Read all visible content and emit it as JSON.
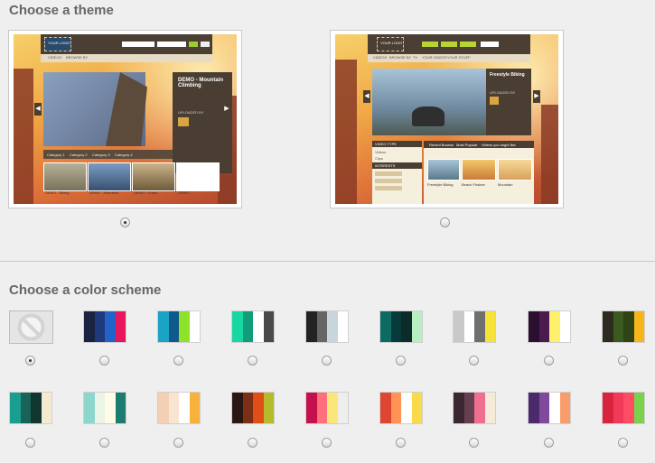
{
  "headings": {
    "theme": "Choose a theme",
    "color": "Choose a color scheme"
  },
  "themes": [
    {
      "logo": "YOUR LOGO",
      "nav": [
        "VIDEOS",
        "BROWSE BY"
      ],
      "hero_title": "DEMO - Mountain Climbing",
      "uploaded_by": "UPLOADED BY",
      "categories": [
        "Category 1",
        "Category 2",
        "Category 3",
        "Category 4"
      ],
      "thumbs": [
        "DEMO - Biking",
        "DEMO - Mountain",
        "DEMO - Cross",
        "DEMO"
      ],
      "selected": true
    },
    {
      "logo": "YOUR LOGO",
      "nav": [
        "VIDEOS",
        "BROWSE BY",
        "TV",
        "YOUR VIDEOS",
        "YOUR STUFF"
      ],
      "hero_title": "Freestyle Biking",
      "uploaded_by": "UPLOADED BY",
      "sidebar": [
        "VIDEO TYPE",
        "Videos",
        "Clips",
        "INTERESTS"
      ],
      "tabs": [
        "Recent Browse",
        "Most Popular",
        "Videos you might like"
      ],
      "thumbs": [
        "Freestyle Biking",
        "Beach Frisbee",
        "Mountain"
      ],
      "selected": false
    }
  ],
  "color_schemes": [
    {
      "colors": [],
      "none": true,
      "selected": true
    },
    {
      "colors": [
        "#1a2340",
        "#1f3a7a",
        "#2263c9",
        "#e8175d"
      ]
    },
    {
      "colors": [
        "#1ba3c6",
        "#0f5a8a",
        "#8de22a",
        "#ffffff"
      ]
    },
    {
      "colors": [
        "#17d8a0",
        "#0f9d7a",
        "#ffffff",
        "#4a4a4a"
      ]
    },
    {
      "colors": [
        "#222222",
        "#666666",
        "#c8d5db",
        "#ffffff"
      ]
    },
    {
      "colors": [
        "#0c6a63",
        "#073a3b",
        "#0d2b29",
        "#b7efc2"
      ]
    },
    {
      "colors": [
        "#c9c9c9",
        "#ffffff",
        "#6f6f6f",
        "#f6e33a"
      ]
    },
    {
      "colors": [
        "#2a0f2f",
        "#4b1b4f",
        "#fdf06a",
        "#ffffff"
      ]
    },
    {
      "colors": [
        "#2d2a22",
        "#3a5a20",
        "#2e4414",
        "#f7b519"
      ]
    },
    {
      "colors": [
        "#1a9e8f",
        "#1a6358",
        "#103630",
        "#f3ead0"
      ]
    },
    {
      "colors": [
        "#8cd6cb",
        "#eaf5e8",
        "#fffbe6",
        "#1d7c70"
      ]
    },
    {
      "colors": [
        "#f3cfb3",
        "#f8e5d1",
        "#ffffff",
        "#f7b23b"
      ]
    },
    {
      "colors": [
        "#2b1712",
        "#7c2f14",
        "#e04f17",
        "#b5bb2b"
      ]
    },
    {
      "colors": [
        "#c4104b",
        "#ff6f7c",
        "#fbe67a",
        "#eeeeee"
      ]
    },
    {
      "colors": [
        "#de4631",
        "#ff9255",
        "#ffffff",
        "#f8da4a"
      ]
    },
    {
      "colors": [
        "#3a2732",
        "#67404f",
        "#ef6f8f",
        "#f6ead9"
      ]
    },
    {
      "colors": [
        "#4a2a6a",
        "#7f4a9b",
        "#ffffff",
        "#f99d6d"
      ]
    },
    {
      "colors": [
        "#d9243d",
        "#f1395a",
        "#ff4c64",
        "#7ad14e"
      ]
    }
  ]
}
